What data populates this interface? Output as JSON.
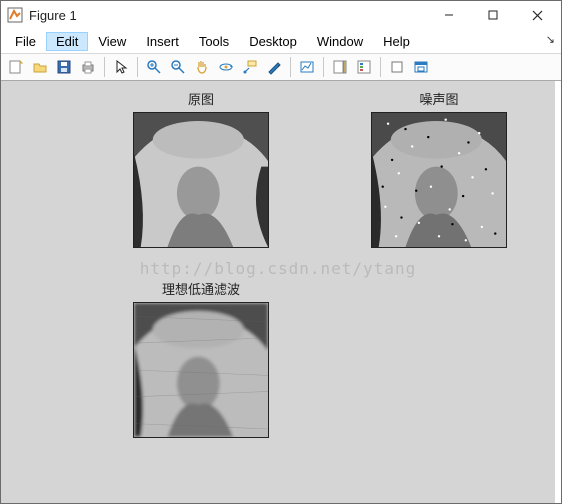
{
  "window": {
    "title": "Figure 1",
    "icon": "matlab-figure-icon"
  },
  "win_controls": {
    "min": "minimize-icon",
    "max": "maximize-icon",
    "close": "close-icon"
  },
  "menubar": {
    "items": [
      {
        "label": "File"
      },
      {
        "label": "Edit"
      },
      {
        "label": "View"
      },
      {
        "label": "Insert"
      },
      {
        "label": "Tools"
      },
      {
        "label": "Desktop"
      },
      {
        "label": "Window"
      },
      {
        "label": "Help"
      }
    ],
    "highlighted": 1,
    "corner_label": "↘"
  },
  "toolbar": {
    "items": [
      {
        "name": "new-figure-icon"
      },
      {
        "name": "open-icon"
      },
      {
        "name": "save-icon"
      },
      {
        "name": "print-icon"
      },
      {
        "sep": true
      },
      {
        "name": "pointer-icon"
      },
      {
        "sep": true
      },
      {
        "name": "zoom-in-icon"
      },
      {
        "name": "zoom-out-icon"
      },
      {
        "name": "pan-icon"
      },
      {
        "name": "rotate-3d-icon"
      },
      {
        "name": "data-cursor-icon"
      },
      {
        "name": "brush-icon"
      },
      {
        "sep": true
      },
      {
        "name": "link-plot-icon"
      },
      {
        "sep": true
      },
      {
        "name": "colorbar-icon"
      },
      {
        "name": "legend-icon"
      },
      {
        "sep": true
      },
      {
        "name": "hide-tools-icon"
      },
      {
        "name": "dock-icon"
      }
    ]
  },
  "subplots": [
    {
      "title": "原图",
      "image_desc": "lena-grayscale-original"
    },
    {
      "title": "噪声图",
      "image_desc": "lena-grayscale-salt-pepper-noise"
    },
    {
      "title": "理想低通滤波",
      "image_desc": "lena-grayscale-ideal-lowpass-filtered"
    }
  ],
  "watermark": "http://blog.csdn.net/ytang"
}
